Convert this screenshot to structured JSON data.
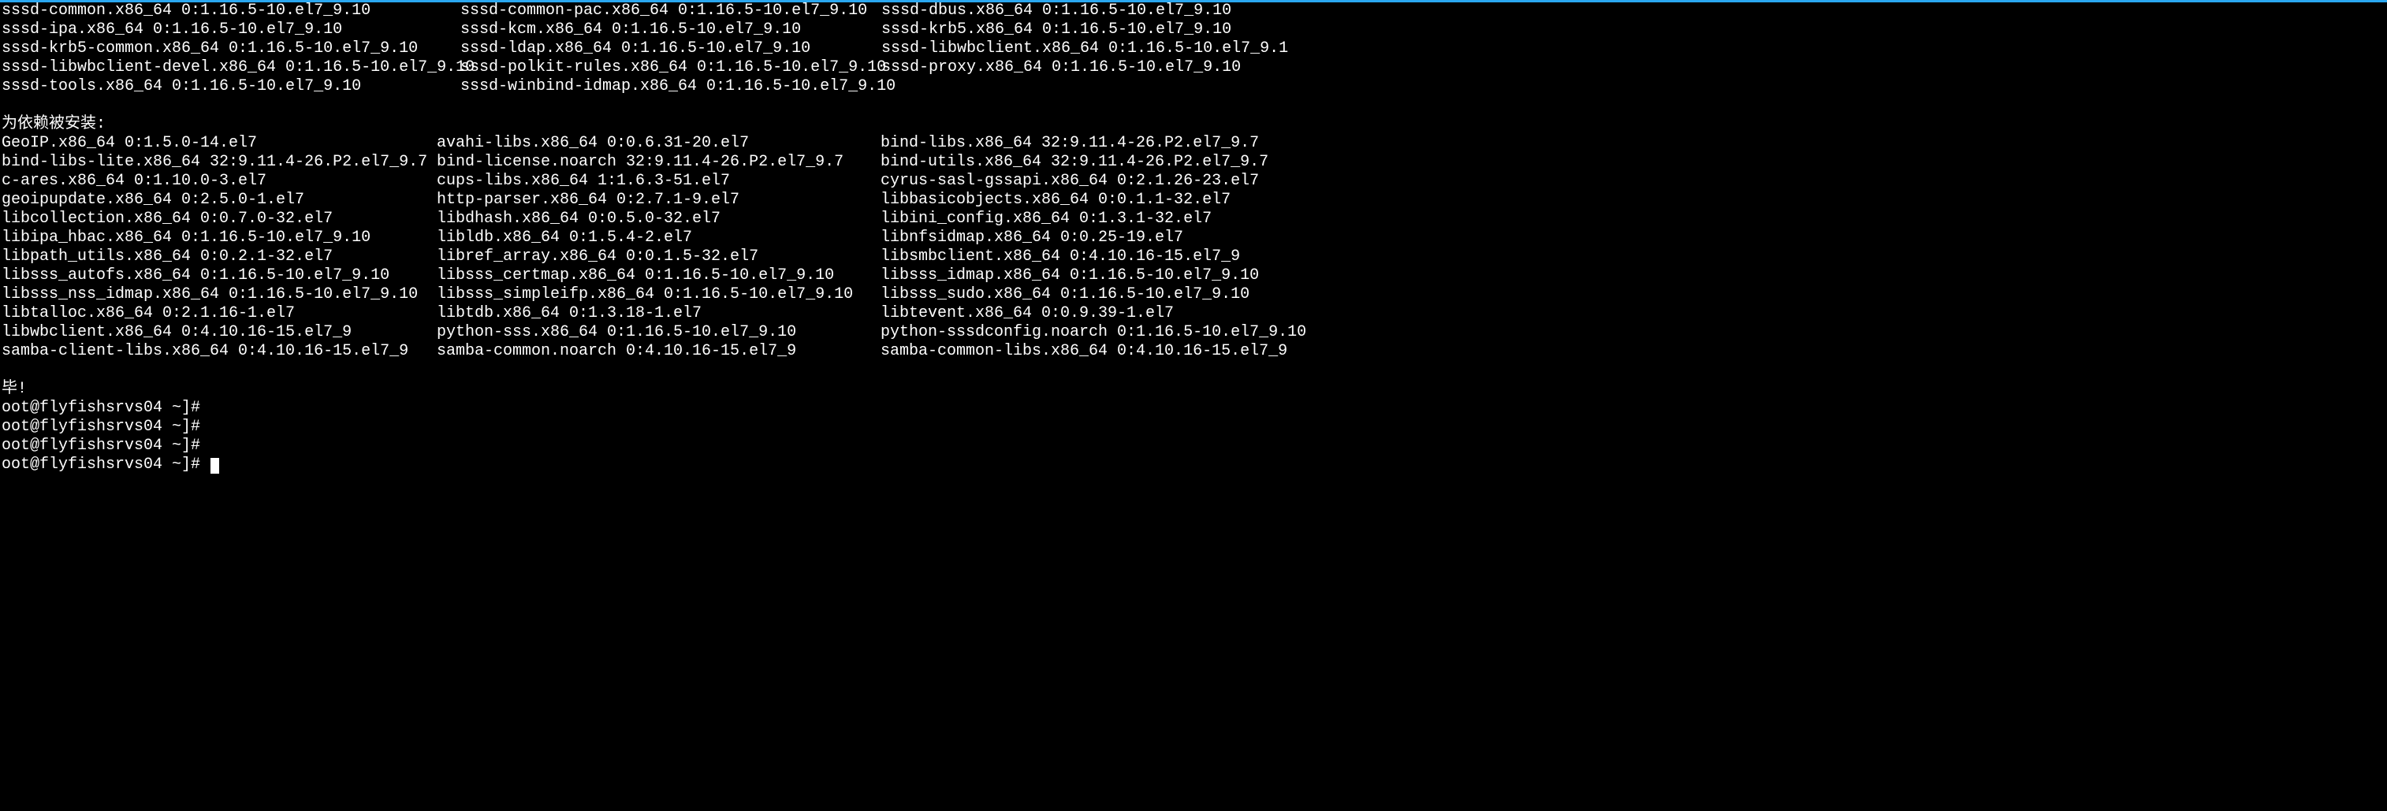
{
  "section1": {
    "col1": [
      "sssd-common.x86_64 0:1.16.5-10.el7_9.10",
      "sssd-ipa.x86_64 0:1.16.5-10.el7_9.10",
      "sssd-krb5-common.x86_64 0:1.16.5-10.el7_9.10",
      "sssd-libwbclient-devel.x86_64 0:1.16.5-10.el7_9.10",
      "sssd-tools.x86_64 0:1.16.5-10.el7_9.10"
    ],
    "col2": [
      "sssd-common-pac.x86_64 0:1.16.5-10.el7_9.10",
      "sssd-kcm.x86_64 0:1.16.5-10.el7_9.10",
      "sssd-ldap.x86_64 0:1.16.5-10.el7_9.10",
      "sssd-polkit-rules.x86_64 0:1.16.5-10.el7_9.10",
      "sssd-winbind-idmap.x86_64 0:1.16.5-10.el7_9.10"
    ],
    "col3": [
      "sssd-dbus.x86_64 0:1.16.5-10.el7_9.10",
      "sssd-krb5.x86_64 0:1.16.5-10.el7_9.10",
      "sssd-libwbclient.x86_64 0:1.16.5-10.el7_9.1",
      "sssd-proxy.x86_64 0:1.16.5-10.el7_9.10",
      ""
    ]
  },
  "deps_header": "为依赖被安装:",
  "section2": {
    "col1": [
      "GeoIP.x86_64 0:1.5.0-14.el7",
      "bind-libs-lite.x86_64 32:9.11.4-26.P2.el7_9.7",
      "c-ares.x86_64 0:1.10.0-3.el7",
      "geoipupdate.x86_64 0:2.5.0-1.el7",
      "libcollection.x86_64 0:0.7.0-32.el7",
      "libipa_hbac.x86_64 0:1.16.5-10.el7_9.10",
      "libpath_utils.x86_64 0:0.2.1-32.el7",
      "libsss_autofs.x86_64 0:1.16.5-10.el7_9.10",
      "libsss_nss_idmap.x86_64 0:1.16.5-10.el7_9.10",
      "libtalloc.x86_64 0:2.1.16-1.el7",
      "libwbclient.x86_64 0:4.10.16-15.el7_9",
      "samba-client-libs.x86_64 0:4.10.16-15.el7_9"
    ],
    "col2": [
      "avahi-libs.x86_64 0:0.6.31-20.el7",
      "bind-license.noarch 32:9.11.4-26.P2.el7_9.7",
      "cups-libs.x86_64 1:1.6.3-51.el7",
      "http-parser.x86_64 0:2.7.1-9.el7",
      "libdhash.x86_64 0:0.5.0-32.el7",
      "libldb.x86_64 0:1.5.4-2.el7",
      "libref_array.x86_64 0:0.1.5-32.el7",
      "libsss_certmap.x86_64 0:1.16.5-10.el7_9.10",
      "libsss_simpleifp.x86_64 0:1.16.5-10.el7_9.10",
      "libtdb.x86_64 0:1.3.18-1.el7",
      "python-sss.x86_64 0:1.16.5-10.el7_9.10",
      "samba-common.noarch 0:4.10.16-15.el7_9"
    ],
    "col3": [
      "bind-libs.x86_64 32:9.11.4-26.P2.el7_9.7",
      "bind-utils.x86_64 32:9.11.4-26.P2.el7_9.7",
      "cyrus-sasl-gssapi.x86_64 0:2.1.26-23.el7",
      "libbasicobjects.x86_64 0:0.1.1-32.el7",
      "libini_config.x86_64 0:1.3.1-32.el7",
      "libnfsidmap.x86_64 0:0.25-19.el7",
      "libsmbclient.x86_64 0:4.10.16-15.el7_9",
      "libsss_idmap.x86_64 0:1.16.5-10.el7_9.10",
      "libsss_sudo.x86_64 0:1.16.5-10.el7_9.10",
      "libtevent.x86_64 0:0.9.39-1.el7",
      "python-sssdconfig.noarch 0:1.16.5-10.el7_9.10",
      "samba-common-libs.x86_64 0:4.10.16-15.el7_9"
    ]
  },
  "complete": "毕!",
  "prompts": [
    "oot@flyfishsrvs04 ~]# ",
    "oot@flyfishsrvs04 ~]# ",
    "oot@flyfishsrvs04 ~]# ",
    "oot@flyfishsrvs04 ~]# "
  ]
}
